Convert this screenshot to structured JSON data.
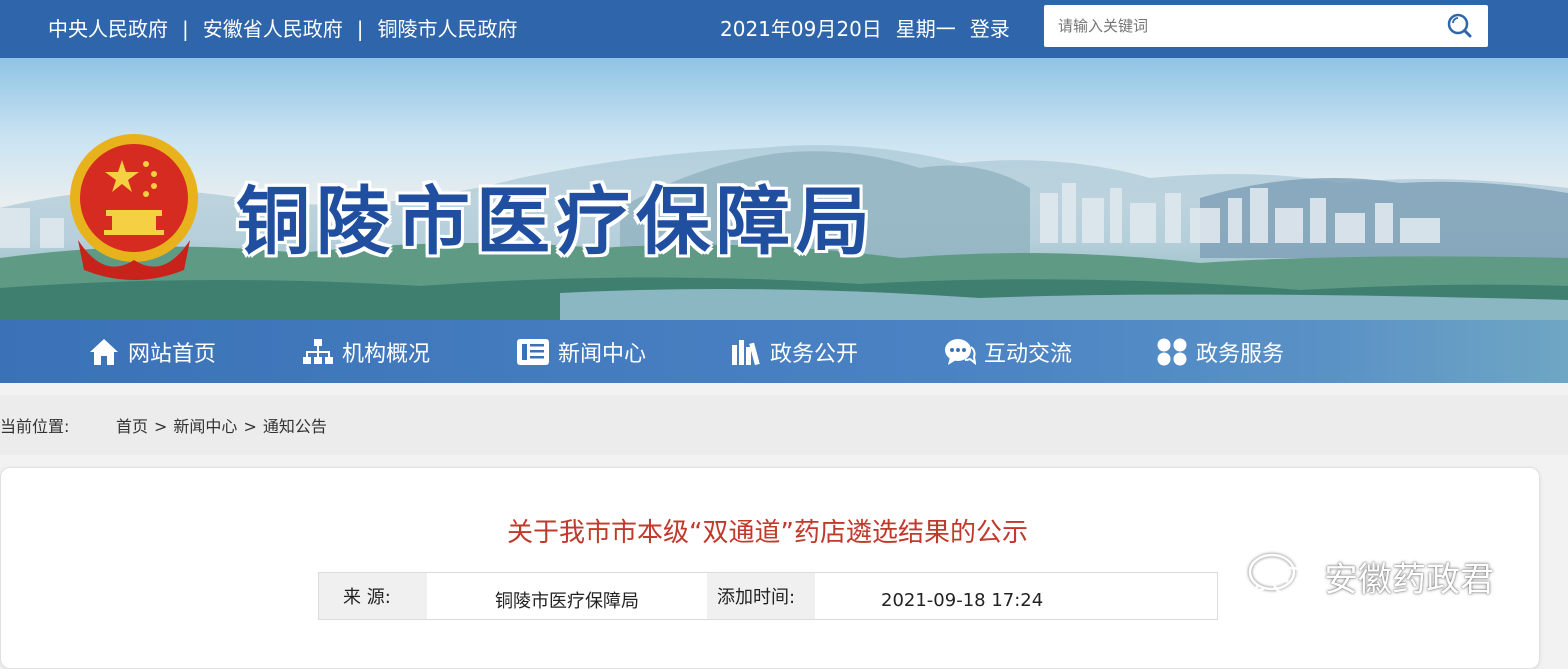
{
  "top_links": [
    "中央人民政府",
    "安徽省人民政府",
    "铜陵市人民政府"
  ],
  "top_separator": "|",
  "date": "2021年09月20日",
  "weekday": "星期一",
  "login_label": "登录",
  "search": {
    "placeholder": "请输入关键词"
  },
  "banner": {
    "site_title": "铜陵市医疗保障局"
  },
  "nav": [
    {
      "label": "网站首页",
      "icon": "home-icon"
    },
    {
      "label": "机构概况",
      "icon": "org-chart-icon"
    },
    {
      "label": "新闻中心",
      "icon": "news-icon"
    },
    {
      "label": "政务公开",
      "icon": "books-icon"
    },
    {
      "label": "互动交流",
      "icon": "chat-icon"
    },
    {
      "label": "政务服务",
      "icon": "grid-icon"
    }
  ],
  "breadcrumb": {
    "label": "当前位置:",
    "items": [
      "首页",
      "新闻中心",
      "通知公告"
    ],
    "separator": ">"
  },
  "article": {
    "title": "关于我市市本级“双通道”药店遴选结果的公示",
    "source_label": "来 源:",
    "source_value": "铜陵市医疗保障局",
    "time_label": "添加时间:",
    "time_value": "2021-09-18 17:24"
  },
  "watermark": {
    "text": "安徽药政君"
  },
  "colors": {
    "top_bar": "#2f66ab",
    "title_text": "#1f4f9e",
    "article_title": "#c0392b",
    "nav_bar": "#3b72b7"
  }
}
